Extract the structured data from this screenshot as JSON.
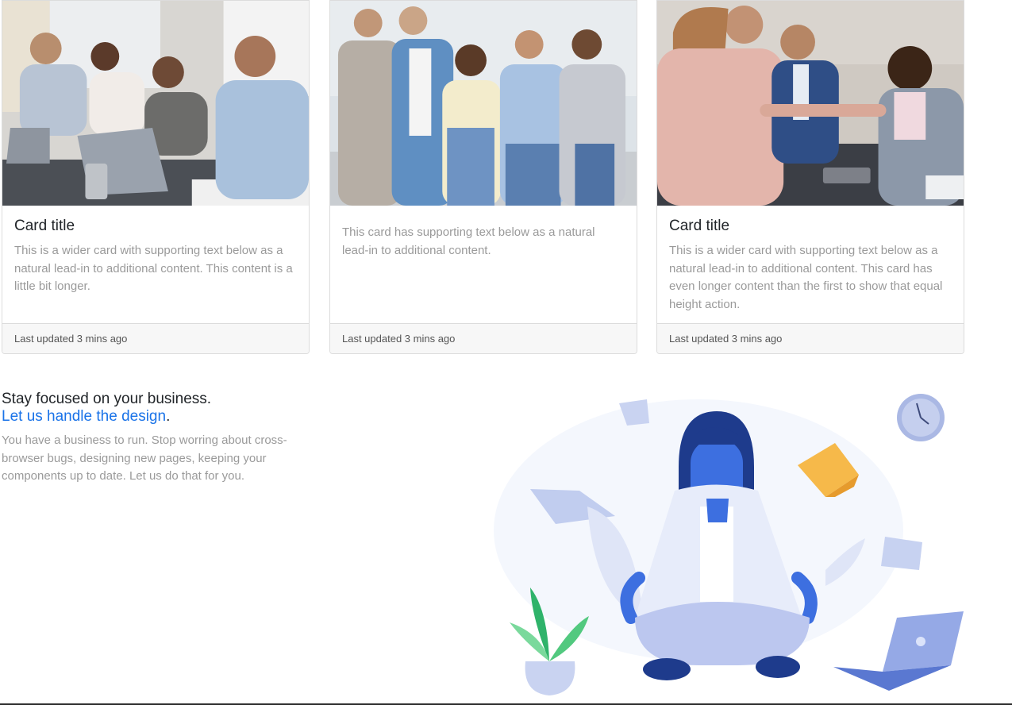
{
  "cards": [
    {
      "image": "team-working-at-laptops-photo",
      "title": "Card title",
      "text": "This is a wider card with supporting text below as a natural lead-in to additional content. This content is a little bit longer.",
      "footer": "Last updated 3 mins ago"
    },
    {
      "image": "business-team-group-portrait-photo",
      "title": "",
      "text": "This card has supporting text below as a natural lead-in to additional content.",
      "footer": "Last updated 3 mins ago"
    },
    {
      "image": "masked-business-handshake-photo",
      "title": "Card title",
      "text": "This is a wider card with supporting text below as a natural lead-in to additional content. This card has even longer content than the first to show that equal height action.",
      "footer": "Last updated 3 mins ago"
    }
  ],
  "promo": {
    "heading": "Stay focused on your business.",
    "link_text": "Let us handle the design",
    "link_suffix": ".",
    "text": "You have a business to run. Stop worring about cross-browser bugs, designing new pages, keeping your components up to date. Let us do that for you.",
    "illustration": "meditating-woman-illustration"
  },
  "colors": {
    "link": "#1a73e8",
    "muted_text": "#9a9a9a",
    "illustration_blue": "#3d6fe0"
  }
}
